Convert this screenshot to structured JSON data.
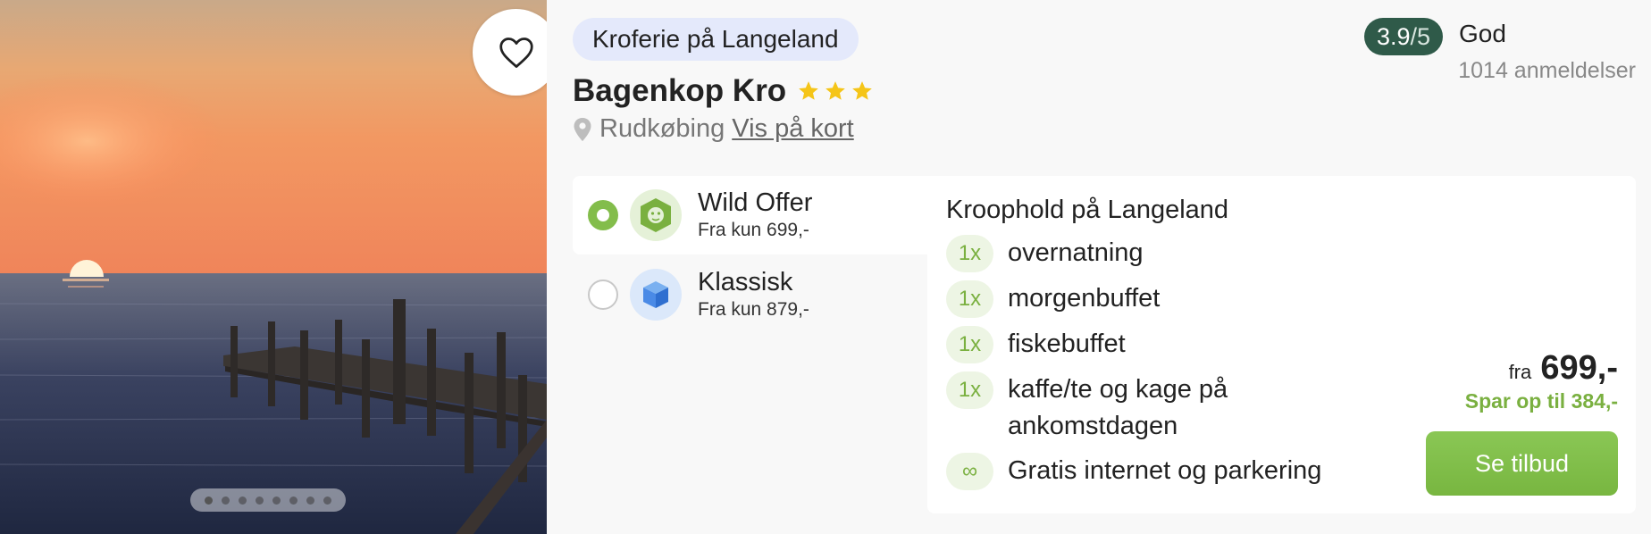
{
  "hotel": {
    "category": "Kroferie på Langeland",
    "name": "Bagenkop Kro",
    "stars": 3,
    "location": "Rudkøbing",
    "map_link": "Vis på kort"
  },
  "rating": {
    "score": "3.9",
    "scale": "/5",
    "word": "God",
    "reviews": "1014 anmeldelser"
  },
  "gallery": {
    "image_count": 8,
    "active_index": 0
  },
  "offers": [
    {
      "name": "Wild Offer",
      "price": "Fra kun 699,-",
      "selected": true,
      "icon": "lion-icon"
    },
    {
      "name": "Klassisk",
      "price": "Fra kun 879,-",
      "selected": false,
      "icon": "box-icon"
    }
  ],
  "details": {
    "title": "Kroophold på Langeland",
    "items": [
      {
        "qty": "1x",
        "label": "overnatning"
      },
      {
        "qty": "1x",
        "label": "morgenbuffet"
      },
      {
        "qty": "1x",
        "label": "fiskebuffet"
      },
      {
        "qty": "1x",
        "label": "kaffe/te og kage på ankomstdagen"
      },
      {
        "qty": "∞",
        "label": "Gratis internet og parkering"
      }
    ]
  },
  "pricing": {
    "from_label": "fra",
    "price": "699,-",
    "savings": "Spar op til 384,-",
    "cta": "Se tilbud"
  },
  "colors": {
    "accent_green": "#83bd4b",
    "rating_bg": "#2f5a49",
    "category_bg": "#e4e9fb",
    "star": "#f5c518"
  }
}
